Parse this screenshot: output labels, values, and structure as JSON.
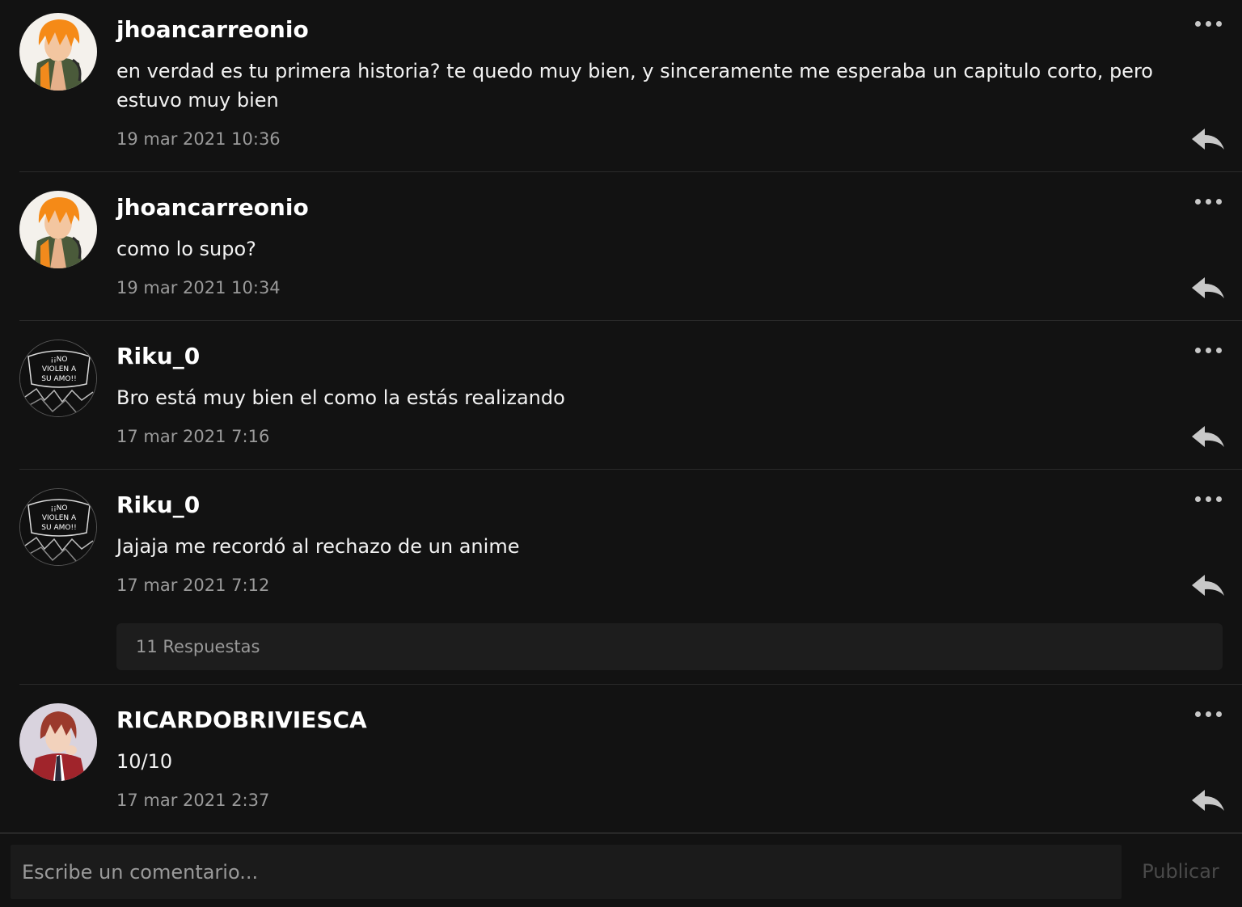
{
  "comments": [
    {
      "username": "jhoancarreonio",
      "text": "en verdad es tu primera historia? te quedo muy bien, y sinceramente me esperaba un capitulo corto, pero estuvo muy bien",
      "timestamp": "19 mar 2021 10:36",
      "avatar": "orange-hair-anime-avatar"
    },
    {
      "username": "jhoancarreonio",
      "text": "como lo supo?",
      "timestamp": "19 mar 2021 10:34",
      "avatar": "orange-hair-anime-avatar"
    },
    {
      "username": "Riku_0",
      "text": "Bro está muy bien el como la estás realizando",
      "timestamp": "17 mar 2021 7:16",
      "avatar": "manga-panel-avatar",
      "avatar_text": [
        "¡¡NO",
        "VIOLEN A",
        "SU AMO!!"
      ]
    },
    {
      "username": "Riku_0",
      "text": "Jajaja me recordó al rechazo de un anime",
      "timestamp": "17 mar 2021 7:12",
      "avatar": "manga-panel-avatar",
      "avatar_text": [
        "¡¡NO",
        "VIOLEN A",
        "SU AMO!!"
      ],
      "replies_label": "11 Respuestas"
    },
    {
      "username": "RICARDOBRIVIESCA",
      "text": "10/10",
      "timestamp": "17 mar 2021 2:37",
      "avatar": "red-hair-anime-avatar"
    }
  ],
  "composer": {
    "placeholder": "Escribe un comentario...",
    "publish_label": "Publicar"
  },
  "colors": {
    "background": "#121212",
    "divider": "#2a2a2a",
    "muted_text": "#9a9a9a",
    "publish_disabled": "#4a4a4a"
  },
  "icons": {
    "more": "more-horizontal-icon",
    "reply": "reply-arrow-icon"
  }
}
